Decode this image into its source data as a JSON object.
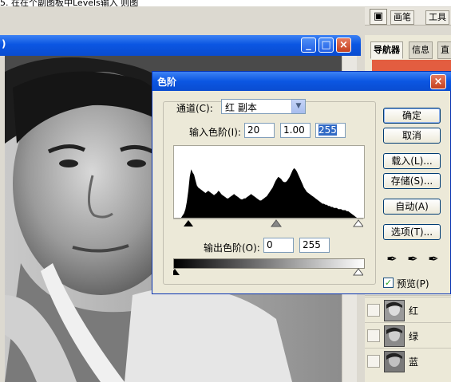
{
  "caption": {
    "text": "5. 在在个副图板中Levels输入         则图"
  },
  "palette_well": {
    "tabs": [
      "画笔",
      "工具"
    ]
  },
  "document": {
    "title": ")",
    "buttons": {
      "minimize": "_",
      "maximize": "□",
      "close": "×"
    }
  },
  "right_panel": {
    "tabs": [
      "导航器",
      "信息",
      "直"
    ],
    "layers": [
      {
        "name": "红"
      },
      {
        "name": "绿"
      },
      {
        "name": "蓝"
      }
    ]
  },
  "levels_dialog": {
    "title": "色阶",
    "channel_label": "通道(C):",
    "channel_value": "红 副本",
    "input_label": "输入色阶(I):",
    "input_values": [
      "20",
      "1.00",
      "255"
    ],
    "output_label": "输出色阶(O):",
    "output_values": [
      "0",
      "255"
    ],
    "buttons": {
      "ok": "确定",
      "cancel": "取消",
      "load": "载入(L)...",
      "save": "存储(S)...",
      "auto": "自动(A)",
      "options": "选项(T)..."
    },
    "preview_label": "预览(P)",
    "preview_checked": true,
    "histogram_profile": [
      0,
      0,
      0,
      0,
      0,
      0,
      2,
      4,
      8,
      15,
      25,
      38,
      45,
      42,
      40,
      35,
      30,
      28,
      27,
      26,
      25,
      24,
      23,
      24,
      25,
      24,
      23,
      22,
      21,
      22,
      23,
      25,
      24,
      22,
      21,
      20,
      19,
      18,
      18,
      19,
      20,
      21,
      22,
      21,
      20,
      19,
      18,
      17,
      17,
      18,
      18,
      19,
      20,
      21,
      22,
      21,
      20,
      19,
      18,
      17,
      16,
      16,
      17,
      18,
      19,
      20,
      22,
      24,
      26,
      28,
      31,
      34,
      36,
      38,
      37,
      36,
      34,
      33,
      33,
      34,
      36,
      38,
      41,
      44,
      46,
      45,
      43,
      40,
      37,
      34,
      31,
      28,
      26,
      24,
      23,
      22,
      21,
      20,
      19,
      18,
      17,
      16,
      15,
      14,
      13,
      13,
      12,
      12,
      11,
      11,
      10,
      10,
      9,
      9,
      9,
      8,
      8,
      8,
      7,
      7,
      7,
      6,
      6,
      5,
      4,
      3,
      2,
      1,
      0,
      0,
      0,
      0,
      0,
      0
    ]
  },
  "colors": {
    "title_bar": "#0b56e2",
    "dialog_bg": "#ece9d8",
    "close_button": "#c4401f"
  }
}
